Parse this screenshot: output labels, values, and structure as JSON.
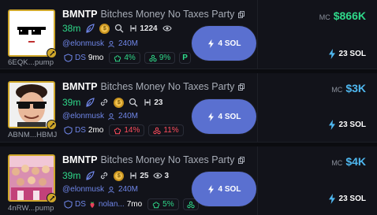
{
  "rows": [
    {
      "ticker": "BMNTP",
      "name": "Bitches Money No Taxes Party",
      "age": "38m",
      "holders": "1224",
      "handle": "@elonmusk",
      "followers": "240M",
      "dev_age": "9mo",
      "pct1": "4%",
      "pct2": "9%",
      "address": "6EQK...pump",
      "buy_label": "4 SOL",
      "mc_label": "MC",
      "mc_value": "$866K",
      "mc_color": "#2fd98a",
      "vol": "23 SOL"
    },
    {
      "ticker": "BMNTP",
      "name": "Bitches Money No Taxes Party",
      "age": "39m",
      "holders": "23",
      "handle": "@elonmusk",
      "followers": "240M",
      "dev_age": "2mo",
      "pct1": "14%",
      "pct2": "11%",
      "address": "ABNM...HBMJ",
      "buy_label": "4 SOL",
      "mc_label": "MC",
      "mc_value": "$3K",
      "mc_color": "#4fb8f0",
      "vol": "23 SOL"
    },
    {
      "ticker": "BMNTP",
      "name": "Bitches Money No Taxes Party",
      "age": "39m",
      "holders": "25",
      "views": "3",
      "handle": "@elonmusk",
      "followers": "240M",
      "dev_name": "nolan...",
      "dev_age": "7mo",
      "pct1": "5%",
      "address": "4nRW...pump",
      "buy_label": "4 SOL",
      "mc_label": "MC",
      "mc_value": "$4K",
      "mc_color": "#4fb8f0",
      "vol": "23 SOL"
    }
  ],
  "ds_label": "DS"
}
